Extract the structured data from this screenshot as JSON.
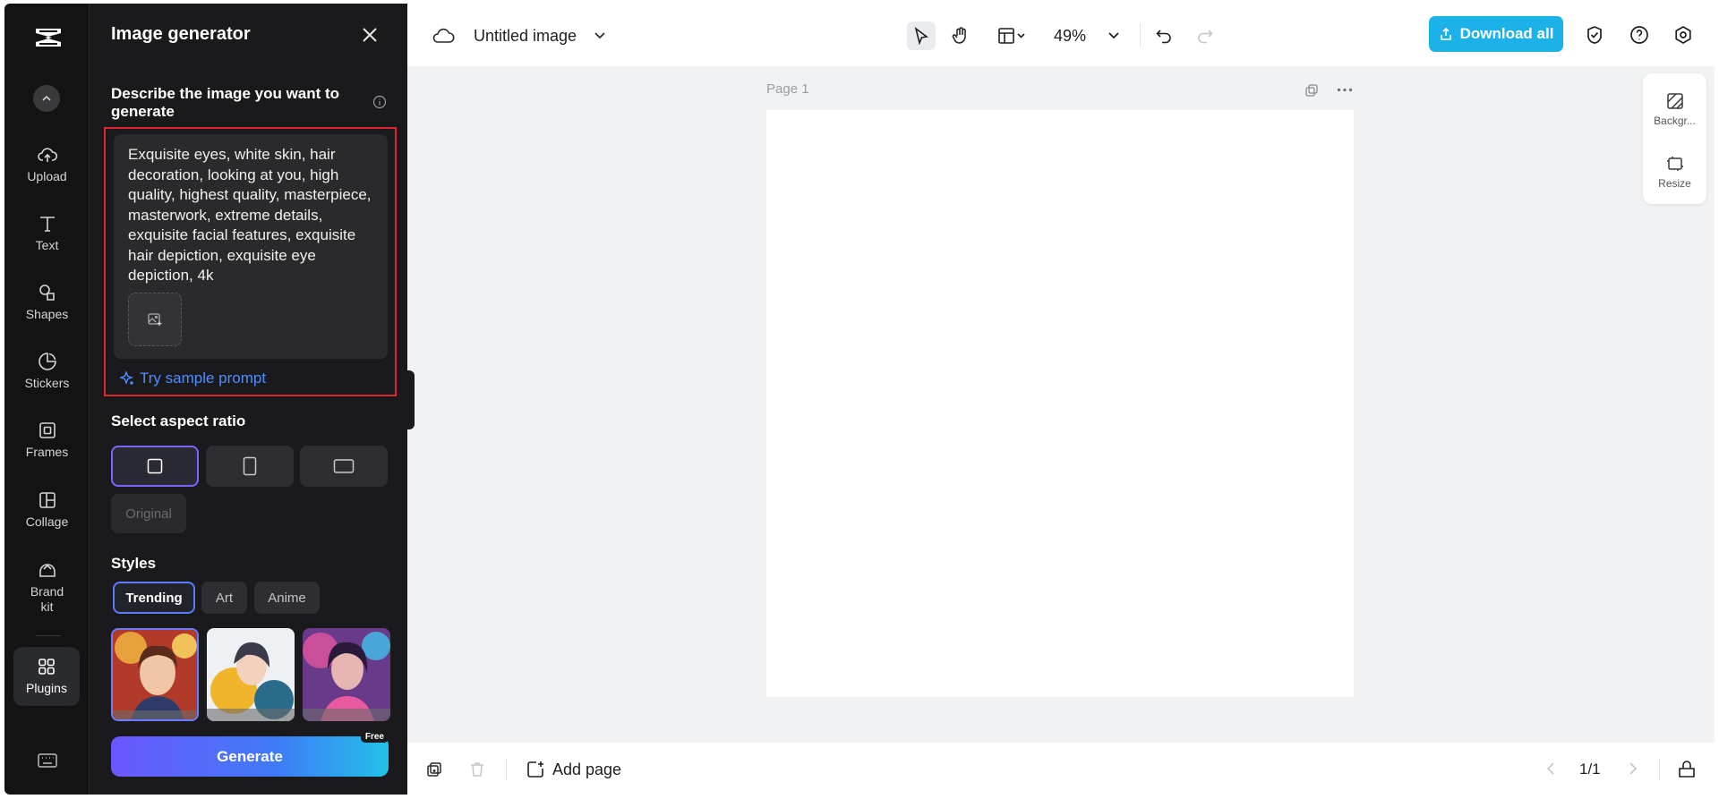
{
  "colors": {
    "accent_blue": "#1cb1e8",
    "prompt_outline": "#e0262f",
    "panel_bg": "#1a1a1c",
    "rail_bg": "#131313"
  },
  "rail": {
    "items": [
      {
        "label": "Upload",
        "icon": "upload-cloud-icon"
      },
      {
        "label": "Text",
        "icon": "text-icon"
      },
      {
        "label": "Shapes",
        "icon": "shapes-icon"
      },
      {
        "label": "Stickers",
        "icon": "stickers-icon"
      },
      {
        "label": "Frames",
        "icon": "frames-icon"
      },
      {
        "label": "Collage",
        "icon": "collage-icon"
      },
      {
        "label": "Brand kit",
        "icon": "brand-kit-icon"
      },
      {
        "label": "Plugins",
        "icon": "plugins-icon"
      }
    ]
  },
  "panel": {
    "title": "Image generator",
    "describe_label": "Describe the image you want to generate",
    "prompt_text": "Exquisite eyes, white skin, hair decoration, looking at you, high quality, highest quality, masterpiece, masterwork, extreme details, exquisite facial features, exquisite hair depiction, exquisite eye depiction, 4k",
    "sample_prompt": "Try sample prompt",
    "aspect_title": "Select aspect ratio",
    "aspect_options": [
      "square",
      "portrait",
      "landscape"
    ],
    "original_label": "Original",
    "styles_title": "Styles",
    "style_tabs": [
      "Trending",
      "Art",
      "Anime"
    ],
    "generate_label": "Generate",
    "free_badge": "Free"
  },
  "topbar": {
    "doc_title": "Untitled image",
    "zoom": "49%",
    "download_label": "Download all"
  },
  "canvas": {
    "page_label": "Page 1",
    "right_tools": [
      "Backgr...",
      "Resize"
    ]
  },
  "bottombar": {
    "add_page": "Add page",
    "pager": "1/1"
  }
}
